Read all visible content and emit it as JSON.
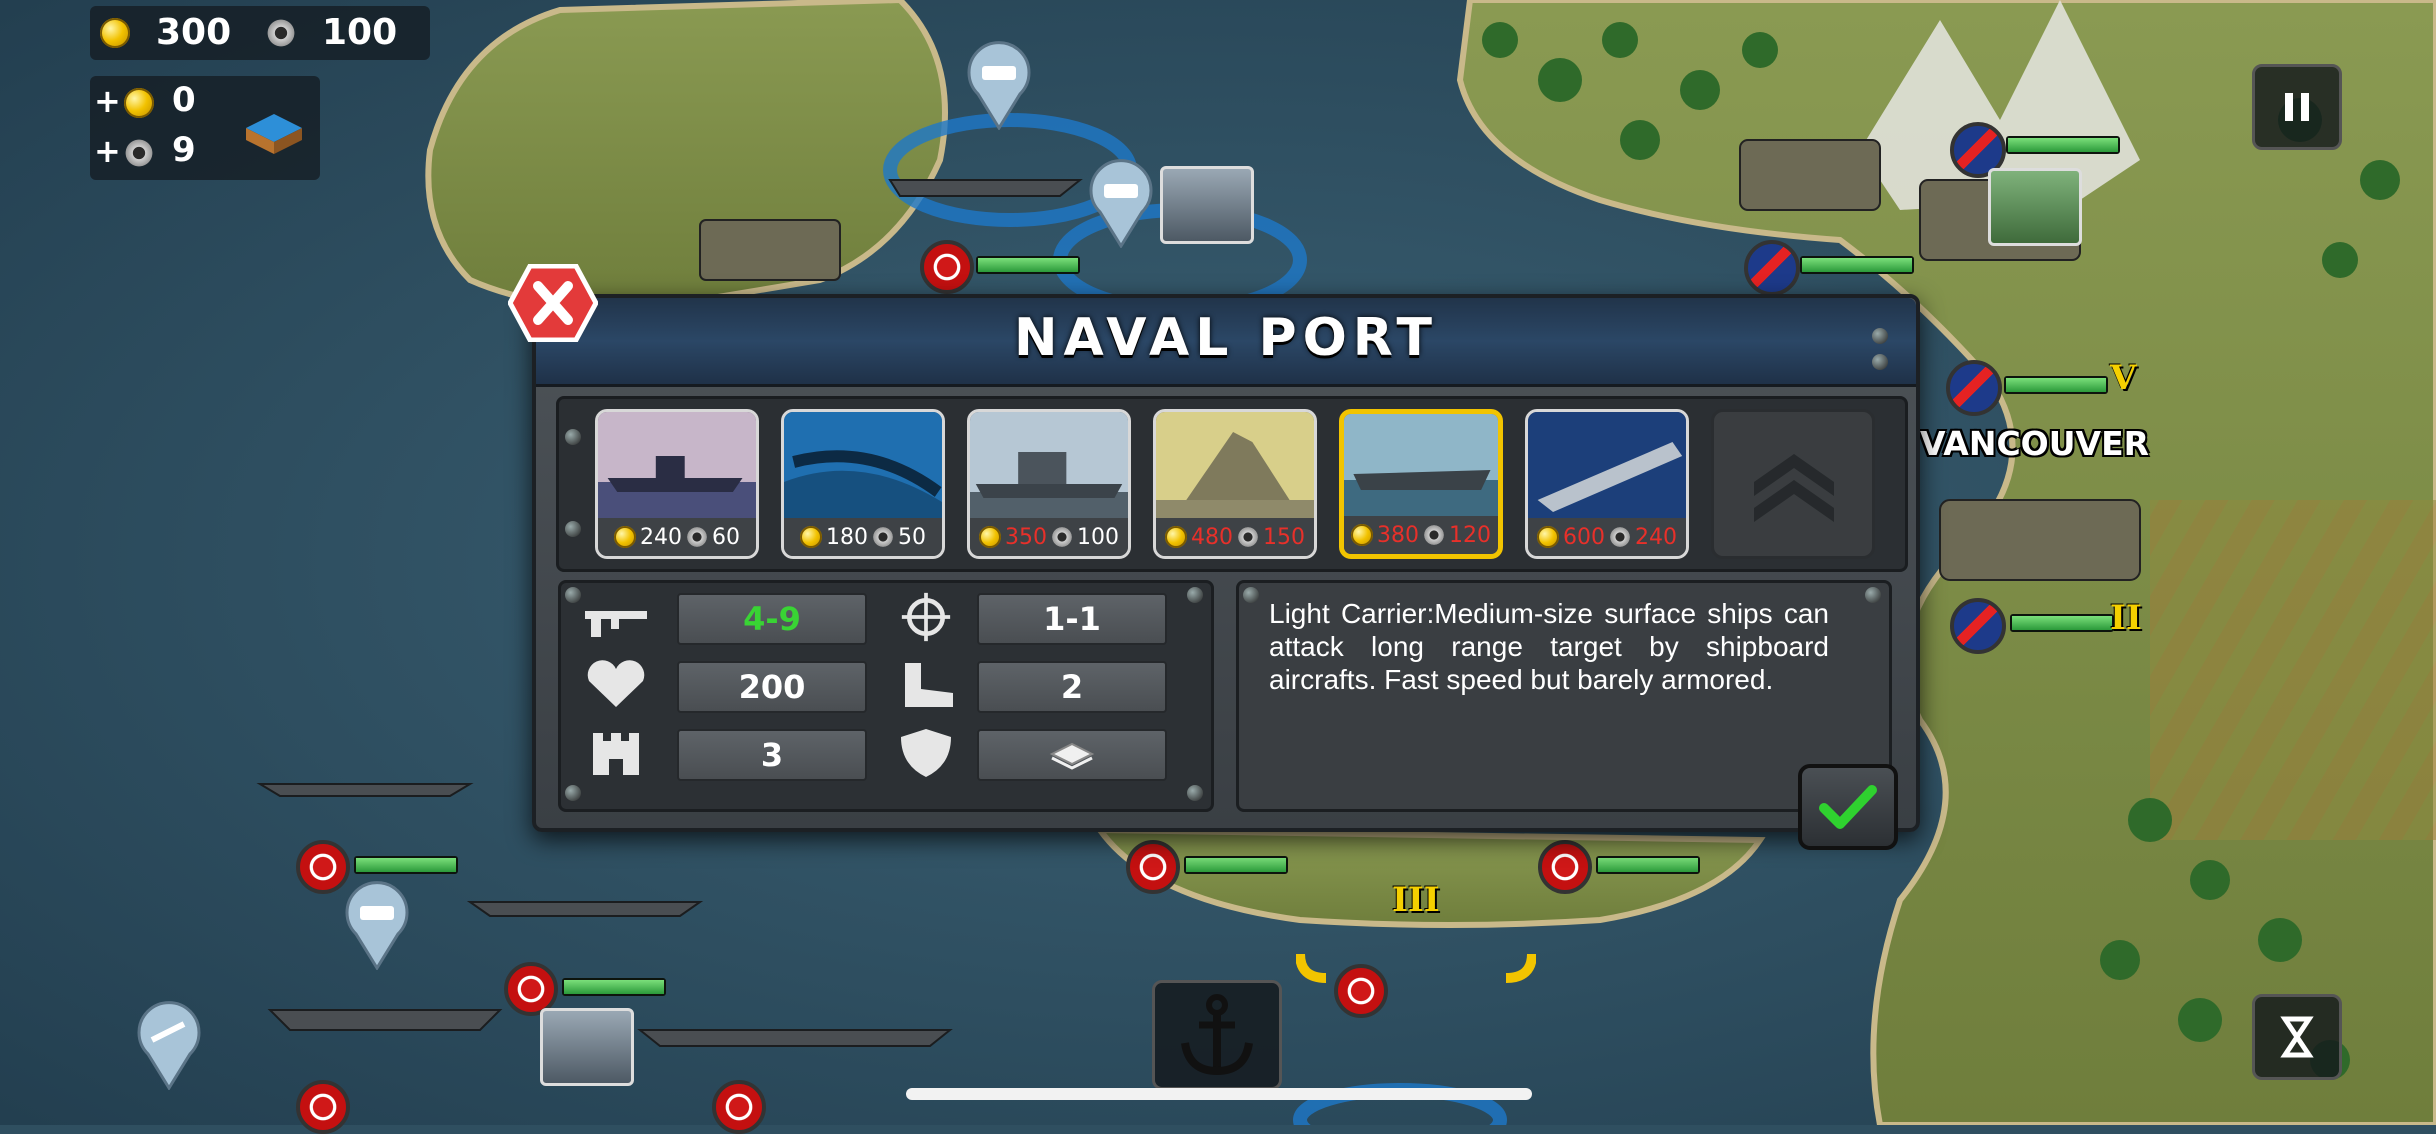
{
  "hud": {
    "gold": "300",
    "steel": "100",
    "gold_income": "0",
    "steel_income": "9",
    "plus_sign": "+"
  },
  "map": {
    "city_label": "VANCOUVER",
    "ranks": [
      "V",
      "II",
      "III"
    ]
  },
  "panel": {
    "title": "NAVAL PORT",
    "units": [
      {
        "name": "destroyer",
        "gold": "240",
        "steel": "60",
        "affordable": true
      },
      {
        "name": "submarine",
        "gold": "180",
        "steel": "50",
        "affordable": true
      },
      {
        "name": "cruiser",
        "gold": "350",
        "steel": "100",
        "affordable": false
      },
      {
        "name": "battleship",
        "gold": "480",
        "steel": "150",
        "affordable": false
      },
      {
        "name": "light-carrier",
        "gold": "380",
        "steel": "120",
        "affordable": false,
        "selected": true
      },
      {
        "name": "aircraft-carrier",
        "gold": "600",
        "steel": "240",
        "affordable": false
      },
      {
        "name": "locked",
        "locked": true
      }
    ],
    "stats": {
      "attack": "4-9",
      "range": "1-1",
      "health": "200",
      "movement": "2",
      "defense_bonus": "3"
    },
    "description": "Light Carrier:Medium-size surface ships can attack long range target by shipboard aircrafts. Fast speed but barely armored."
  },
  "colors": {
    "attack_text": "#39d434",
    "cost_unaffordable": "#e8302a",
    "selection_frame": "#f2c400",
    "header_blue": "#2b4766"
  }
}
